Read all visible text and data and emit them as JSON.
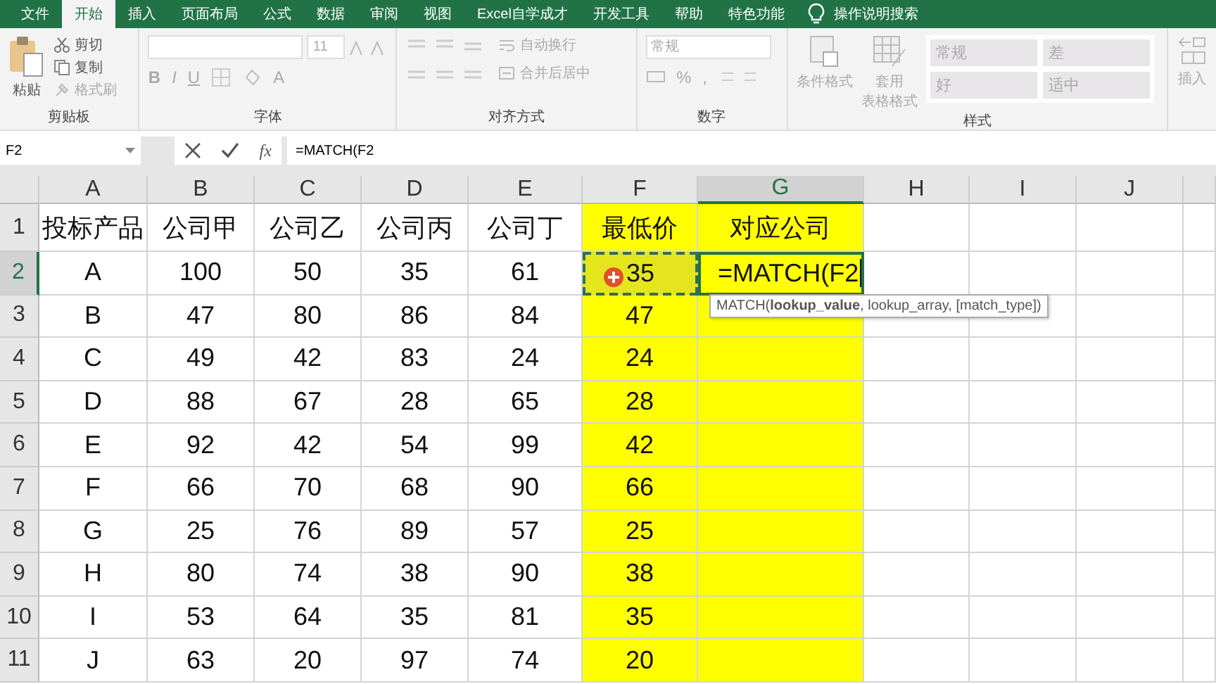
{
  "ribbon_tabs": [
    {
      "label": "文件",
      "selected": false
    },
    {
      "label": "开始",
      "selected": true
    },
    {
      "label": "插入",
      "selected": false
    },
    {
      "label": "页面布局",
      "selected": false
    },
    {
      "label": "公式",
      "selected": false
    },
    {
      "label": "数据",
      "selected": false
    },
    {
      "label": "审阅",
      "selected": false
    },
    {
      "label": "视图",
      "selected": false
    },
    {
      "label": "Excel自学成才",
      "selected": false
    },
    {
      "label": "开发工具",
      "selected": false
    },
    {
      "label": "帮助",
      "selected": false
    },
    {
      "label": "特色功能",
      "selected": false
    }
  ],
  "tell_me": "操作说明搜索",
  "ribbon": {
    "clipboard": {
      "paste": "粘贴",
      "cut": "剪切",
      "copy": "复制",
      "format_painter": "格式刷",
      "label": "剪贴板"
    },
    "font": {
      "font_size": "11",
      "bold": "B",
      "italic": "I",
      "underline": "U",
      "font_color": "A",
      "label": "字体"
    },
    "alignment": {
      "wrap_text": "自动换行",
      "merge_center": "合并后居中",
      "label": "对齐方式"
    },
    "number": {
      "format": "常规",
      "percent": "%",
      "comma": ",",
      "label": "数字"
    },
    "styles": {
      "conditional": "条件格式",
      "table_format_1": "套用",
      "table_format_2": "表格格式",
      "cells": [
        "常规",
        "差",
        "好",
        "适中"
      ],
      "label": "样式"
    },
    "cells": {
      "insert": "插入"
    }
  },
  "formula_bar": {
    "name_box": "F2",
    "fx": "fx",
    "formula": "=MATCH(F2"
  },
  "columns": [
    {
      "letter": "A",
      "selected": false
    },
    {
      "letter": "B",
      "selected": false
    },
    {
      "letter": "C",
      "selected": false
    },
    {
      "letter": "D",
      "selected": false
    },
    {
      "letter": "E",
      "selected": false
    },
    {
      "letter": "F",
      "selected": false
    },
    {
      "letter": "G",
      "selected": true
    },
    {
      "letter": "H",
      "selected": false
    },
    {
      "letter": "I",
      "selected": false
    },
    {
      "letter": "J",
      "selected": false
    }
  ],
  "rows": [
    {
      "number": "1",
      "selected": false,
      "cells": [
        {
          "text": "投标产品",
          "highlighted": false,
          "kind": "normal"
        },
        {
          "text": "公司甲",
          "highlighted": false,
          "kind": "normal"
        },
        {
          "text": "公司乙",
          "highlighted": false,
          "kind": "normal"
        },
        {
          "text": "公司丙",
          "highlighted": false,
          "kind": "normal"
        },
        {
          "text": "公司丁",
          "highlighted": false,
          "kind": "normal"
        },
        {
          "text": "最低价",
          "highlighted": true,
          "kind": "normal"
        },
        {
          "text": "对应公司",
          "highlighted": true,
          "kind": "normal"
        }
      ]
    },
    {
      "number": "2",
      "selected": true,
      "cells": [
        {
          "text": "A",
          "highlighted": false,
          "kind": "normal"
        },
        {
          "text": "100",
          "highlighted": false,
          "kind": "normal"
        },
        {
          "text": "50",
          "highlighted": false,
          "kind": "normal"
        },
        {
          "text": "35",
          "highlighted": false,
          "kind": "normal"
        },
        {
          "text": "61",
          "highlighted": false,
          "kind": "normal"
        },
        {
          "text": "35",
          "highlighted": true,
          "kind": "copy_source"
        },
        {
          "text": "=MATCH(F2",
          "highlighted": true,
          "kind": "editing"
        }
      ]
    },
    {
      "number": "3",
      "selected": false,
      "cells": [
        {
          "text": "B",
          "highlighted": false,
          "kind": "normal"
        },
        {
          "text": "47",
          "highlighted": false,
          "kind": "normal"
        },
        {
          "text": "80",
          "highlighted": false,
          "kind": "normal"
        },
        {
          "text": "86",
          "highlighted": false,
          "kind": "normal"
        },
        {
          "text": "84",
          "highlighted": false,
          "kind": "normal"
        },
        {
          "text": "47",
          "highlighted": true,
          "kind": "normal"
        },
        {
          "text": "",
          "highlighted": true,
          "kind": "normal"
        }
      ]
    },
    {
      "number": "4",
      "selected": false,
      "cells": [
        {
          "text": "C",
          "highlighted": false,
          "kind": "normal"
        },
        {
          "text": "49",
          "highlighted": false,
          "kind": "normal"
        },
        {
          "text": "42",
          "highlighted": false,
          "kind": "normal"
        },
        {
          "text": "83",
          "highlighted": false,
          "kind": "normal"
        },
        {
          "text": "24",
          "highlighted": false,
          "kind": "normal"
        },
        {
          "text": "24",
          "highlighted": true,
          "kind": "normal"
        },
        {
          "text": "",
          "highlighted": true,
          "kind": "normal"
        }
      ]
    },
    {
      "number": "5",
      "selected": false,
      "cells": [
        {
          "text": "D",
          "highlighted": false,
          "kind": "normal"
        },
        {
          "text": "88",
          "highlighted": false,
          "kind": "normal"
        },
        {
          "text": "67",
          "highlighted": false,
          "kind": "normal"
        },
        {
          "text": "28",
          "highlighted": false,
          "kind": "normal"
        },
        {
          "text": "65",
          "highlighted": false,
          "kind": "normal"
        },
        {
          "text": "28",
          "highlighted": true,
          "kind": "normal"
        },
        {
          "text": "",
          "highlighted": true,
          "kind": "normal"
        }
      ]
    },
    {
      "number": "6",
      "selected": false,
      "cells": [
        {
          "text": "E",
          "highlighted": false,
          "kind": "normal"
        },
        {
          "text": "92",
          "highlighted": false,
          "kind": "normal"
        },
        {
          "text": "42",
          "highlighted": false,
          "kind": "normal"
        },
        {
          "text": "54",
          "highlighted": false,
          "kind": "normal"
        },
        {
          "text": "99",
          "highlighted": false,
          "kind": "normal"
        },
        {
          "text": "42",
          "highlighted": true,
          "kind": "normal"
        },
        {
          "text": "",
          "highlighted": true,
          "kind": "normal"
        }
      ]
    },
    {
      "number": "7",
      "selected": false,
      "cells": [
        {
          "text": "F",
          "highlighted": false,
          "kind": "normal"
        },
        {
          "text": "66",
          "highlighted": false,
          "kind": "normal"
        },
        {
          "text": "70",
          "highlighted": false,
          "kind": "normal"
        },
        {
          "text": "68",
          "highlighted": false,
          "kind": "normal"
        },
        {
          "text": "90",
          "highlighted": false,
          "kind": "normal"
        },
        {
          "text": "66",
          "highlighted": true,
          "kind": "normal"
        },
        {
          "text": "",
          "highlighted": true,
          "kind": "normal"
        }
      ]
    },
    {
      "number": "8",
      "selected": false,
      "cells": [
        {
          "text": "G",
          "highlighted": false,
          "kind": "normal"
        },
        {
          "text": "25",
          "highlighted": false,
          "kind": "normal"
        },
        {
          "text": "76",
          "highlighted": false,
          "kind": "normal"
        },
        {
          "text": "89",
          "highlighted": false,
          "kind": "normal"
        },
        {
          "text": "57",
          "highlighted": false,
          "kind": "normal"
        },
        {
          "text": "25",
          "highlighted": true,
          "kind": "normal"
        },
        {
          "text": "",
          "highlighted": true,
          "kind": "normal"
        }
      ]
    },
    {
      "number": "9",
      "selected": false,
      "cells": [
        {
          "text": "H",
          "highlighted": false,
          "kind": "normal"
        },
        {
          "text": "80",
          "highlighted": false,
          "kind": "normal"
        },
        {
          "text": "74",
          "highlighted": false,
          "kind": "normal"
        },
        {
          "text": "38",
          "highlighted": false,
          "kind": "normal"
        },
        {
          "text": "90",
          "highlighted": false,
          "kind": "normal"
        },
        {
          "text": "38",
          "highlighted": true,
          "kind": "normal"
        },
        {
          "text": "",
          "highlighted": true,
          "kind": "normal"
        }
      ]
    },
    {
      "number": "10",
      "selected": false,
      "cells": [
        {
          "text": "I",
          "highlighted": false,
          "kind": "normal"
        },
        {
          "text": "53",
          "highlighted": false,
          "kind": "normal"
        },
        {
          "text": "64",
          "highlighted": false,
          "kind": "normal"
        },
        {
          "text": "35",
          "highlighted": false,
          "kind": "normal"
        },
        {
          "text": "81",
          "highlighted": false,
          "kind": "normal"
        },
        {
          "text": "35",
          "highlighted": true,
          "kind": "normal"
        },
        {
          "text": "",
          "highlighted": true,
          "kind": "normal"
        }
      ]
    },
    {
      "number": "11",
      "selected": false,
      "cells": [
        {
          "text": "J",
          "highlighted": false,
          "kind": "normal"
        },
        {
          "text": "63",
          "highlighted": false,
          "kind": "normal"
        },
        {
          "text": "20",
          "highlighted": false,
          "kind": "normal"
        },
        {
          "text": "97",
          "highlighted": false,
          "kind": "normal"
        },
        {
          "text": "74",
          "highlighted": false,
          "kind": "normal"
        },
        {
          "text": "20",
          "highlighted": true,
          "kind": "normal"
        },
        {
          "text": "",
          "highlighted": true,
          "kind": "normal"
        }
      ]
    }
  ],
  "tooltip": "MATCH(**lookup_value**, lookup_array, [match_type])"
}
